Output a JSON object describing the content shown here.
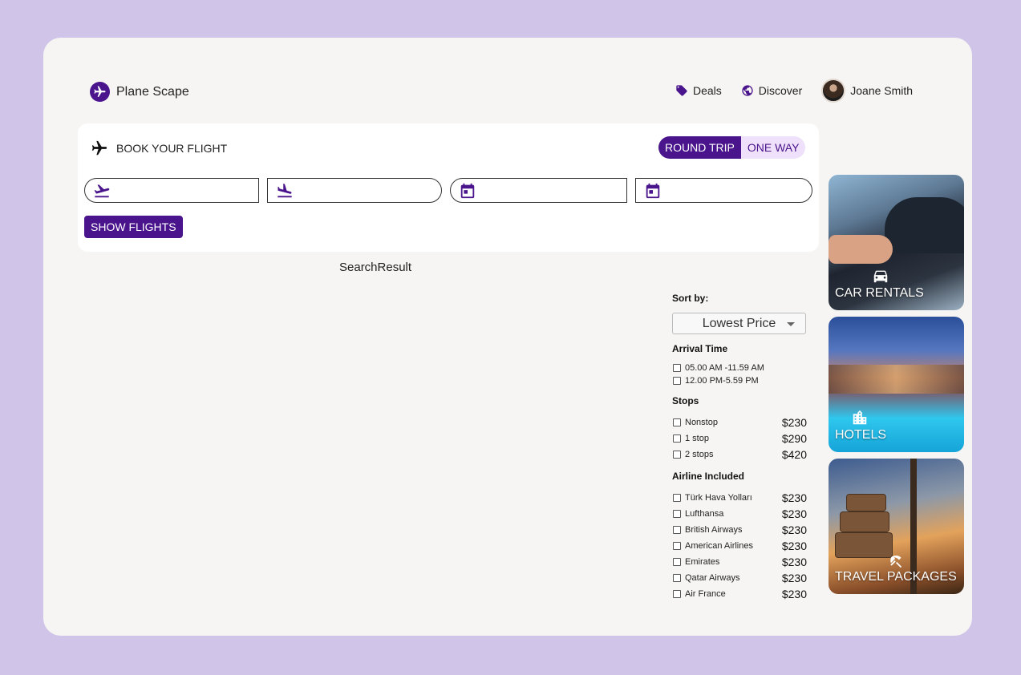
{
  "brand": {
    "name": "Plane Scape",
    "icon": "airplane-icon"
  },
  "nav": {
    "deals": {
      "label": "Deals",
      "icon": "tag-icon"
    },
    "discover": {
      "label": "Discover",
      "icon": "globe-icon"
    },
    "user": {
      "name": "Joane Smith"
    }
  },
  "booking": {
    "title": "BOOK YOUR FLIGHT",
    "trip_types": {
      "round_trip": "ROUND TRIP",
      "one_way": "ONE WAY"
    },
    "selected_trip": "ROUND TRIP",
    "fields": {
      "from": {
        "icon": "flight-takeoff-icon",
        "value": ""
      },
      "to": {
        "icon": "flight-land-icon",
        "value": ""
      },
      "depart": {
        "icon": "calendar-icon",
        "value": ""
      },
      "return": {
        "icon": "calendar-icon",
        "value": ""
      }
    },
    "show_flights": "SHOW FLIGHTS"
  },
  "search_result_label": "SearchResult",
  "filters": {
    "sort_label": "Sort by:",
    "sort_value": "Lowest Price",
    "arrival_label": "Arrival Time",
    "arrival_options": [
      "05.00 AM -11.59 AM",
      "12.00 PM-5.59 PM"
    ],
    "stops_label": "Stops",
    "stops": [
      {
        "label": "Nonstop",
        "price": "$230"
      },
      {
        "label": "1 stop",
        "price": "$290"
      },
      {
        "label": "2 stops",
        "price": "$420"
      }
    ],
    "airline_label": "Airline Included",
    "airlines": [
      {
        "label": "Türk Hava Yolları",
        "price": "$230"
      },
      {
        "label": "Lufthansa",
        "price": "$230"
      },
      {
        "label": "British Airways",
        "price": "$230"
      },
      {
        "label": "American Airlines",
        "price": "$230"
      },
      {
        "label": "Emirates",
        "price": "$230"
      },
      {
        "label": "Qatar Airways",
        "price": "$230"
      },
      {
        "label": "Air France",
        "price": "$230"
      }
    ]
  },
  "tiles": [
    {
      "label": "CAR RENTALS",
      "icon": "car-icon"
    },
    {
      "label": "HOTELS",
      "icon": "hotel-icon"
    },
    {
      "label": "TRAVEL PACKAGES",
      "icon": "beach-umbrella-icon"
    }
  ],
  "colors": {
    "primary": "#4a148c",
    "accent_light": "#efe1fb",
    "background": "#d1c4e9",
    "surface": "#f6f5f4"
  }
}
